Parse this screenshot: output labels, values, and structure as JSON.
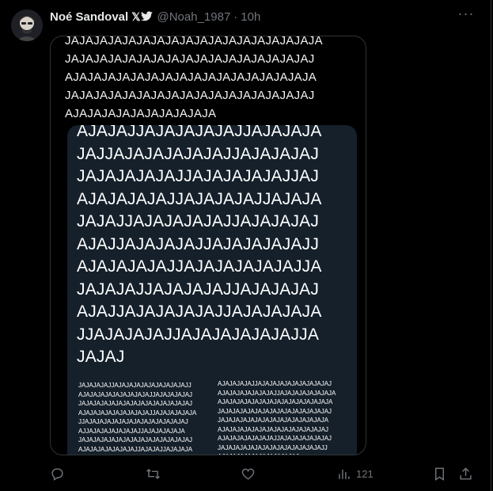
{
  "tweet": {
    "author_name": "Noé Sandoval",
    "badge": "𝕏",
    "handle": "@Noah_1987",
    "separator": "·",
    "time": "10h",
    "more": "···",
    "views": "121"
  },
  "media": {
    "top_lines": [
      "JAJAJAJAJAJAJAJAJAJAJAJAJAJAJAJAJAJA",
      "JAJAJAJAJAJAJAJAJAJAJAJAJAJAJAJAJAJ",
      "AJAJAJAJAJAJAJAJAJAJAJAJAJAJAJAJAJA",
      "JAJAJAJAJAJAJAJAJAJAJAJAJAJAJAJAJAJ",
      "AJAJAJAJAJAJAJAJAJAJA"
    ],
    "big_lines": [
      "AJAJAJJAJAJAJAJAJJAJAJAJA",
      "JAJJAJAJAJAJAJAJJAJAJAJAJ",
      "JAJAJAJAJAJJAJAJAJAJAJJAJ",
      "AJAJAJAJAJJAJAJAJAJJAJAJA",
      "JAJAJJAJAJAJAJAJJAJAJAJAJ",
      "AJAJJAJAJAJAJJAJAJAJAJAJJ",
      "AJAJAJAJAJJAJAJAJAJAJAJJA",
      "JAJAJAJJAJAJAJAJJAJAJAJAJ",
      "AJAJJAJAJAJAJAJJAJAJAJAJA",
      "JJAJAJAJAJJAJAJAJAJAJAJJA",
      "JAJAJ"
    ],
    "small_left_lines": [
      "JAJAJAJAJJAJAJAJAJAJAJAJAJAJAJJ",
      "AJAJAJAJAJAJAJAJAJAJJAJAJAJAJAJ",
      "JAJAJAJAJAJAJAJAJAJAJAJAJAJAJAJ",
      "AJAJAJAJAJAJAJAJAJAJJAJAJAJAJAJA",
      "JJAJAJAJAJAJAJAJAJAJAJAJAJAJAJ",
      "AJJAJAJAJAJAJAJAJJAJAJAJAJAJA",
      "JAJAJAJAJAJAJAJAJAJAJAJAJAJAJAJ",
      "AJAJAJAJAJAJAJAJJAJAJAJJAJAJAJA",
      "JAJAJAJAJAJAJAJAJAJAJAJAJAJAJ",
      "AJAJAJAJAJAJAJAJAJAJAJAJAJA"
    ],
    "small_right_lines": [
      "AJAJAJAJAJJAJAJAJAJAJAJAJAJAJAJ",
      "AJAJAJAJAJAJAJAJJAJAJAJAJAJAJAJA",
      "AJAJAJAJAJAJAJAJAJAJAJAJAJAJAJA",
      "JAJAJAJAJAJAJAJAJAJAJAJAJAJAJAJ",
      "JAJAJAJAJAJAJAJAJAJAJAJAJAJAJA",
      "AJAJAJAJAJAJAJAJAJAJAJAJAJAJAJ",
      "AJAJAJAJAJAJAJAJJAJAJAJAJAJAJAJ",
      "JAJAJAJAJAJAJAJAJAJAJAJAJAJAJJ",
      "AJAJAJAJAJAJAJAJAJAJAJ"
    ]
  },
  "icons": {
    "reply": "reply-icon",
    "retweet": "retweet-icon",
    "like": "like-icon",
    "views": "views-icon",
    "bookmark": "bookmark-icon",
    "share": "share-icon"
  },
  "colors": {
    "background": "#000000",
    "text": "#e7e9ea",
    "muted": "#71767b",
    "border": "#2f3336",
    "media_inner": "#15202b"
  }
}
